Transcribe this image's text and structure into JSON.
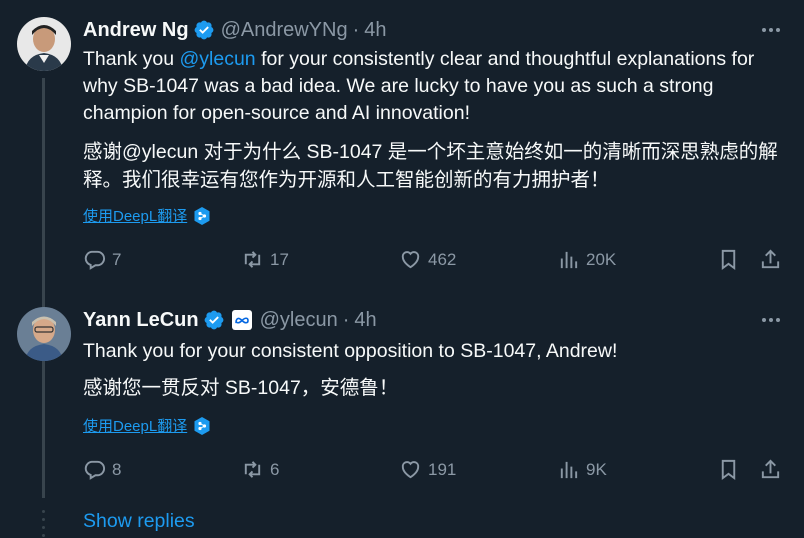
{
  "tweets": [
    {
      "name": "Andrew Ng",
      "handle": "@AndrewYNg",
      "separator": "·",
      "time": "4h",
      "text_pre": "Thank you ",
      "mention": "@ylecun",
      "text_post": " for your consistently clear and thoughtful explanations for why SB-1047 was a bad idea. We are lucky to have you as such a strong champion for open-source and AI innovation!",
      "translation": "感谢@ylecun 对于为什么 SB-1047 是一个坏主意始终如一的清晰而深思熟虑的解释。我们很幸运有您作为开源和人工智能创新的有力拥护者！",
      "translate_label": "使用DeepL翻译",
      "replies": "7",
      "retweets": "17",
      "likes": "462",
      "views": "20K"
    },
    {
      "name": "Yann LeCun",
      "handle": "@ylecun",
      "separator": "·",
      "time": "4h",
      "text": "Thank you for your consistent opposition to SB-1047, Andrew!",
      "translation": "感谢您一贯反对 SB-1047，安德鲁！",
      "translate_label": "使用DeepL翻译",
      "replies": "8",
      "retweets": "6",
      "likes": "191",
      "views": "9K"
    }
  ],
  "show_replies": "Show replies",
  "colors": {
    "background": "#15202b",
    "accent": "#1d9bf0",
    "muted": "#8b98a5",
    "thread_line": "#38444d"
  },
  "icons": [
    "verified-badge-icon",
    "meta-affiliation-icon",
    "more-icon",
    "reply-icon",
    "retweet-icon",
    "like-icon",
    "views-icon",
    "bookmark-icon",
    "share-icon",
    "deepl-icon"
  ]
}
